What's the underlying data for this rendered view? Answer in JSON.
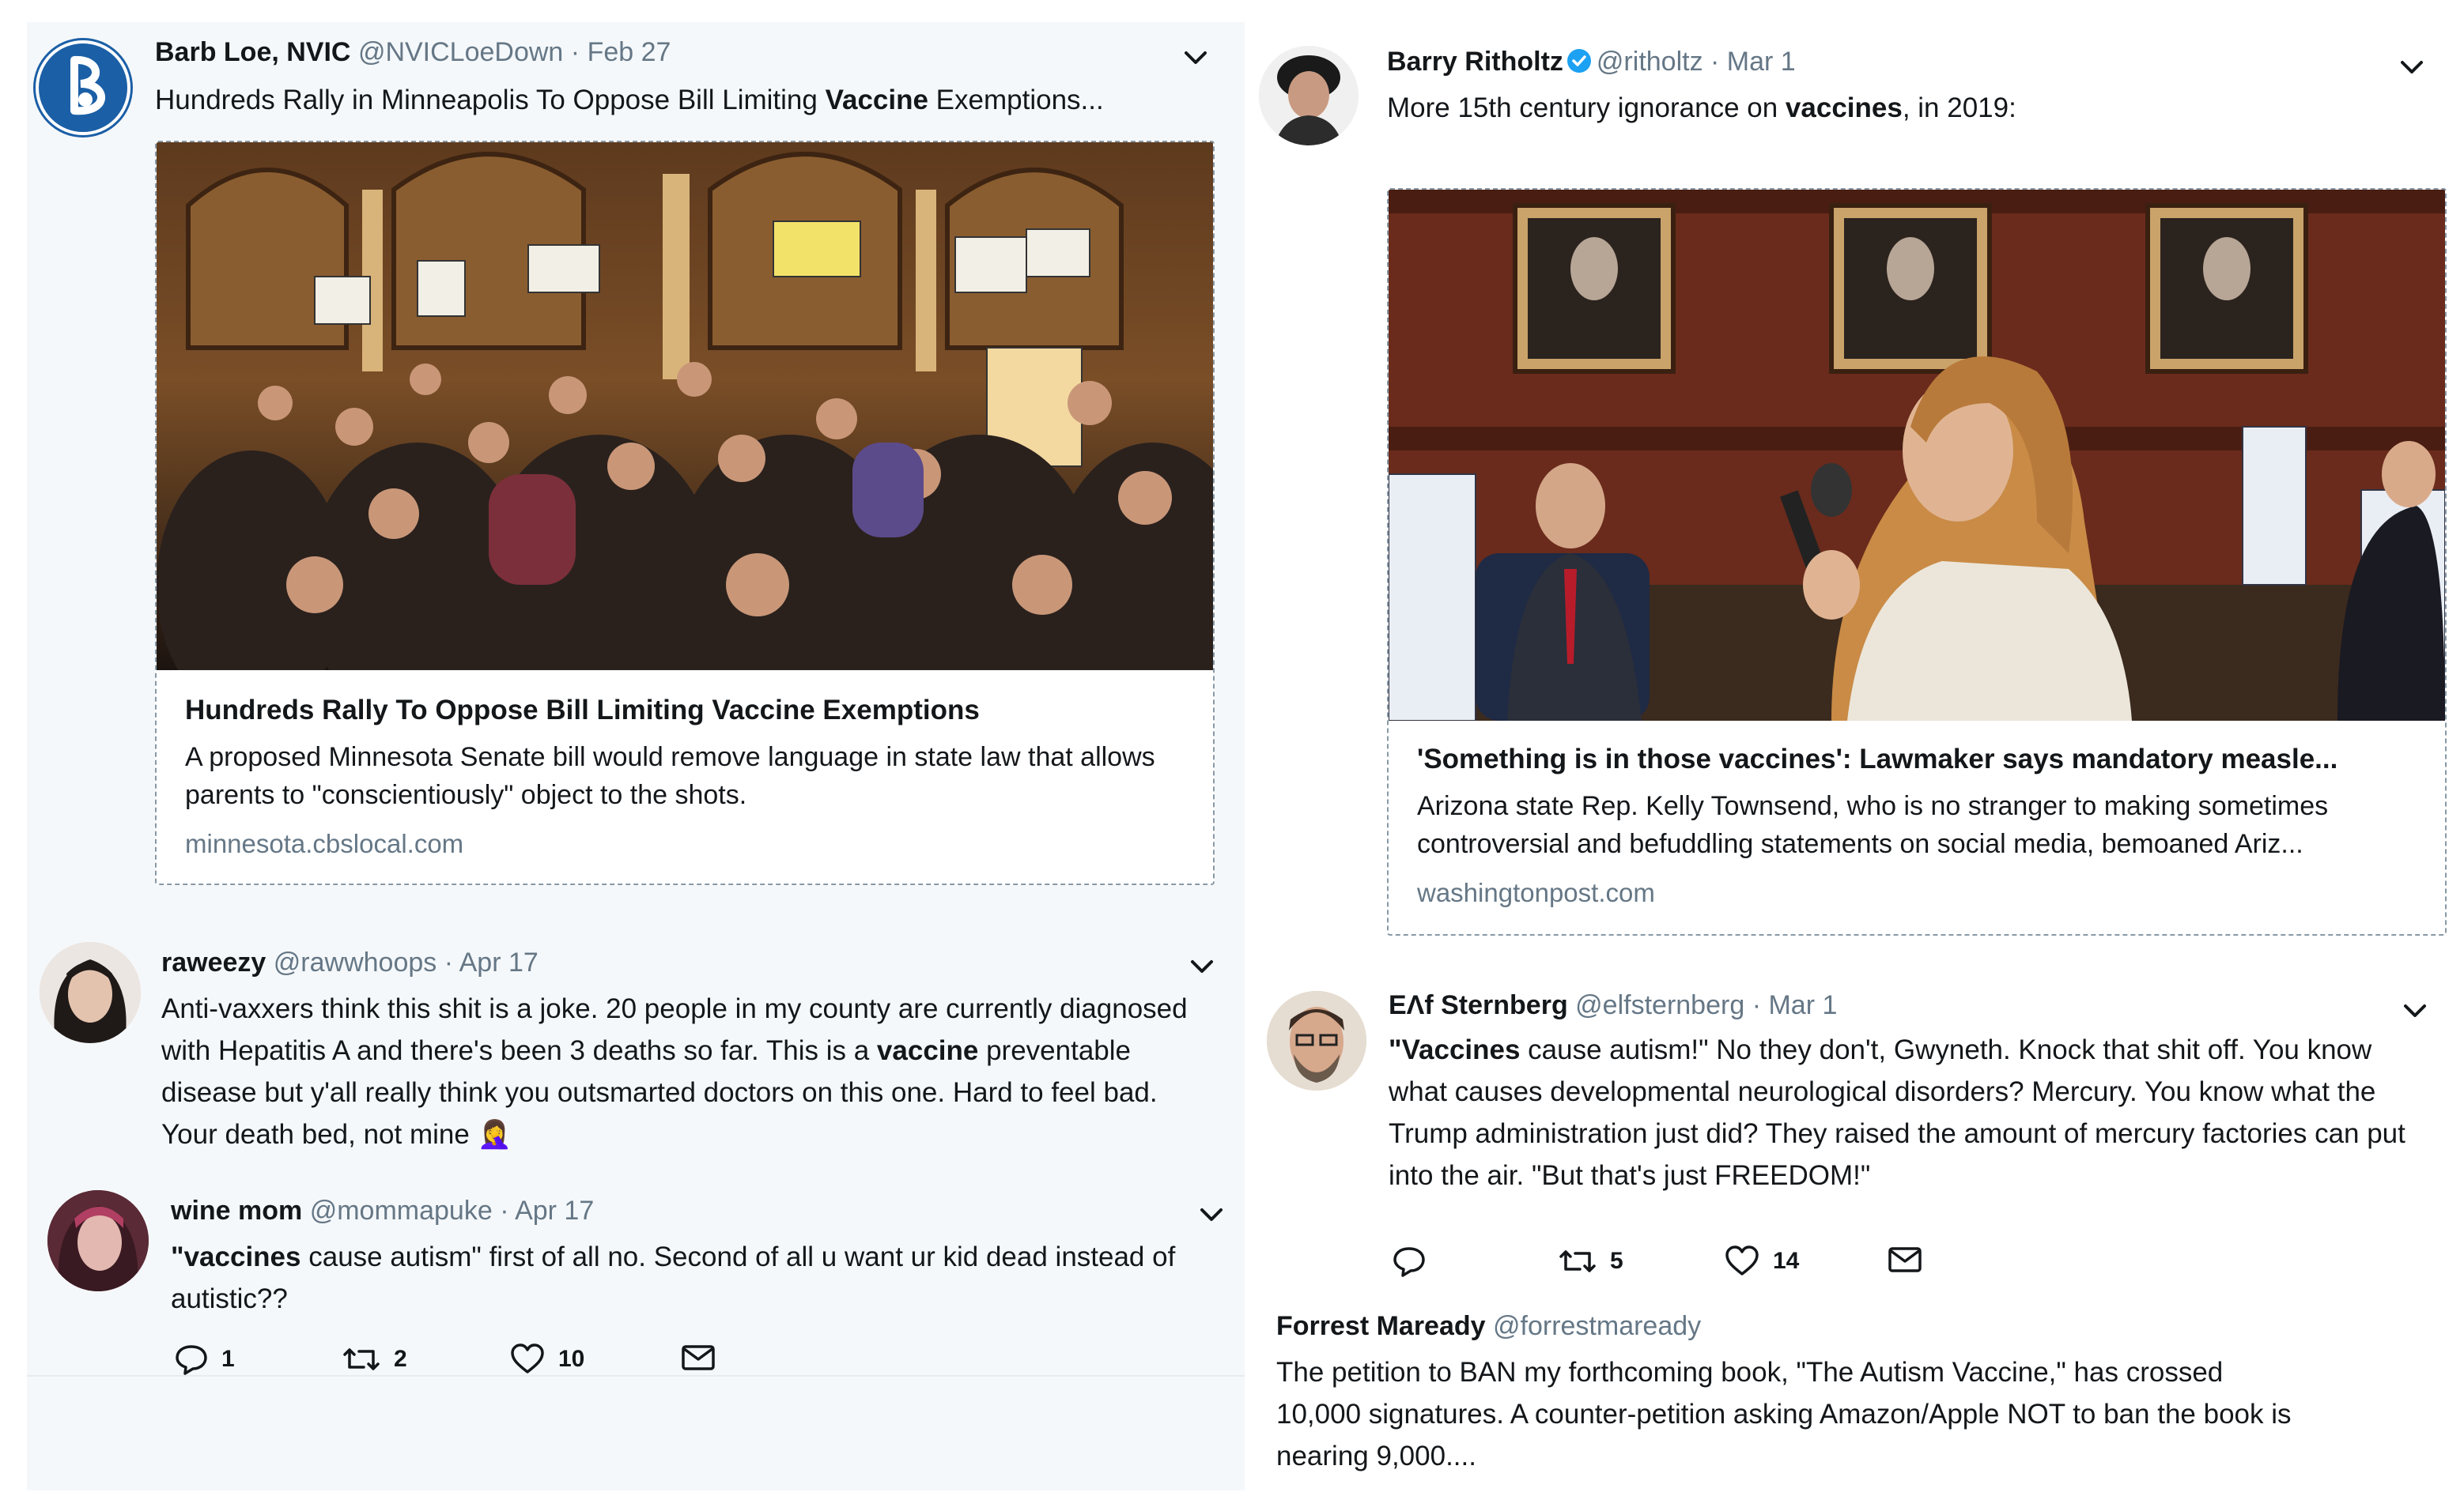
{
  "tweets": [
    {
      "name": "Barb Loe, NVIC",
      "handle": "@NVICLoeDown",
      "date": "· Feb 27",
      "text_before": "Hundreds Rally in Minneapolis To Oppose Bill Limiting ",
      "text_bold": "Vaccine",
      "text_after": " Exemptions...",
      "card": {
        "title": "Hundreds Rally To Oppose Bill Limiting Vaccine Exemptions",
        "description": "A proposed Minnesota Senate bill would remove language in state law that allows parents to \"conscientiously\" object to the shots.",
        "domain": "minnesota.cbslocal.com"
      }
    },
    {
      "name": "raweezy",
      "handle": "@rawwhoops",
      "date": "· Apr 17",
      "text_before": "Anti-vaxxers think this shit is a joke. 20 people in my county are currently diagnosed with Hepatitis A and there's been 3 deaths so far. This is a ",
      "text_bold": "vaccine",
      "text_after": " preventable disease but y'all really think you outsmarted doctors on this one. Hard to feel bad. Your death bed, not mine 🤦‍♀️"
    },
    {
      "name": "wine mom",
      "handle": "@mommapuke",
      "date": "· Apr 17",
      "text_bold": "\"vaccines",
      "text_after": " cause autism\" first of all no. Second of all u want ur kid dead instead of autistic??",
      "reply_count": "1",
      "retweet_count": "2",
      "like_count": "10"
    },
    {
      "name": "Barry Ritholtz",
      "handle": "@ritholtz",
      "date": "· Mar 1",
      "text_before": "More 15th century ignorance on ",
      "text_bold": "vaccines",
      "text_after": ", in 2019:",
      "card": {
        "title": "'Something is in those vaccines': Lawmaker says mandatory measle...",
        "description": "Arizona state Rep. Kelly Townsend, who is no stranger to making sometimes controversial and befuddling statements on social media, bemoaned Ariz...",
        "domain": "washingtonpost.com"
      }
    },
    {
      "name": "EΛf Sternberg",
      "handle": "@elfsternberg",
      "date": "· Mar 1",
      "text_bold": "\"Vaccines",
      "text_after": " cause autism!\" No they don't, Gwyneth. Knock that shit off. You know what causes developmental neurological disorders? Mercury. You know what the Trump administration just did? They raised the amount of mercury factories can put into the air. \"But that's just FREEDOM!\"",
      "retweet_count": "5",
      "like_count": "14"
    },
    {
      "name": "Forrest Maready",
      "handle": "@forrestmaready",
      "text": "The petition to BAN my forthcoming book, \"The Autism Vaccine,\" has crossed 10,000 signatures. A counter-petition asking Amazon/Apple NOT to ban the book is nearing 9,000...."
    }
  ],
  "colors": {
    "left_background": "#f5f8fa",
    "secondary_text": "#657786",
    "verified_blue": "#1da1f2",
    "icon_gray": "#657786"
  },
  "icons": [
    "reply-icon",
    "retweet-icon",
    "like-icon",
    "message-icon",
    "chevron-down-icon",
    "verified-badge-icon"
  ]
}
